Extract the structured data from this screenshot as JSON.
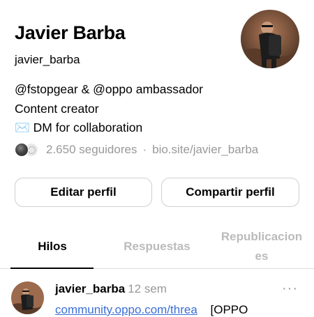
{
  "profile": {
    "name": "Javier Barba",
    "handle": "javier_barba",
    "bio": {
      "line1_mention1": "@fstopgear",
      "line1_amp": " & ",
      "line1_mention2": "@oppo",
      "line1_rest": " ambassador",
      "line2": "Content creator",
      "line3_emoji": "✉️",
      "line3_text": " DM for collaboration"
    },
    "followers": "2.650 seguidores",
    "separator": "·",
    "link": "bio.site/javier_barba"
  },
  "actions": {
    "edit_label": "Editar perfil",
    "share_label": "Compartir perfil"
  },
  "tabs": [
    {
      "label": "Hilos",
      "active": true
    },
    {
      "label": "Respuestas",
      "active": false
    },
    {
      "label": "Republicaciones",
      "active": false
    }
  ],
  "post": {
    "author": "javier_barba",
    "time": "12 sem",
    "more": "···",
    "link_text": "community.oppo.com/threa",
    "text_after": "[OPPO"
  },
  "colors": {
    "link": "#3b6fd6",
    "muted": "#999999",
    "border": "#cfcfcf"
  }
}
